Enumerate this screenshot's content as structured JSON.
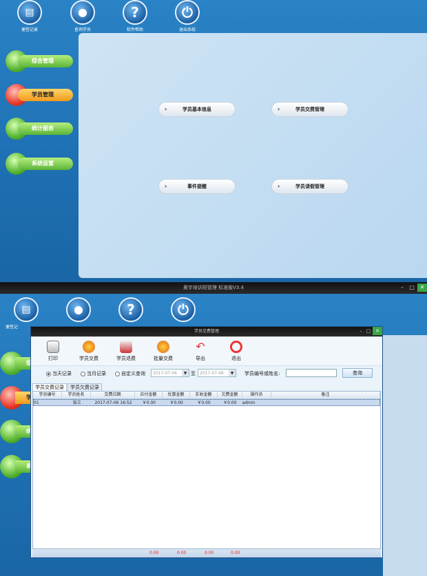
{
  "top_toolbar": [
    {
      "label": "便签记录",
      "icon": "notes-icon"
    },
    {
      "label": "查询学员",
      "icon": "user-search-icon"
    },
    {
      "label": "软件帮助",
      "icon": "help-icon"
    },
    {
      "label": "退出系统",
      "icon": "power-icon"
    }
  ],
  "sidebar": [
    "综合管理",
    "学员管理",
    "统计报表",
    "系统设置"
  ],
  "menu": [
    "学员基本信息",
    "学员交费管理",
    "事件提醒",
    "学员请假管理"
  ],
  "main_title": "奥宇培训班管理 标准版V3.4",
  "bottom_sidebar": [
    "综",
    "学",
    "统",
    "系"
  ],
  "bottom_top": {
    "first_label": "便签记"
  },
  "window": {
    "title": "学员交费管理",
    "tools": [
      "打印",
      "学员交费",
      "学员退费",
      "批量交费",
      "导出",
      "退出"
    ],
    "filter": {
      "r1": "当天记录",
      "r2": "当月记录",
      "r3": "自定义查询",
      "from": "2017-07-06",
      "to_label": "至",
      "to": "2017-07-06",
      "search_label": "学员编号或姓名:",
      "query": "查询"
    },
    "tabs": [
      "学员交费记录",
      "学员欠费记录"
    ],
    "columns": [
      "学员编号",
      "学员姓名",
      "交费日期",
      "应付金额",
      "优惠金额",
      "实收金额",
      "欠费金额",
      "操作员",
      "备注"
    ],
    "rows": [
      [
        "01",
        "张三",
        "2017-07-06 16:52",
        "￥0.00",
        "￥0.00",
        "￥0.00",
        "￥0.00",
        "admin",
        ""
      ]
    ],
    "footer": [
      "0.00",
      "0.00",
      "0.00",
      "0.00"
    ]
  },
  "colors": {
    "accent": "#1d6fb2",
    "green": "#56b532",
    "red": "#e83a2a"
  }
}
